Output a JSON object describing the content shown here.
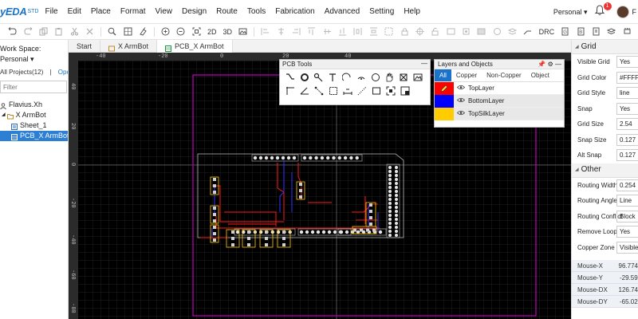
{
  "app": {
    "logo": "yEDA",
    "logo_suffix": "STD"
  },
  "menu": [
    "File",
    "Edit",
    "Place",
    "Format",
    "View",
    "Design",
    "Route",
    "Tools",
    "Fabrication",
    "Advanced",
    "Setting",
    "Help"
  ],
  "account": {
    "workspace_dropdown": "Personal",
    "notification_count": "1",
    "user_initial": "F"
  },
  "toolbar": {
    "zoom_2d": "2D",
    "zoom_3d": "3D",
    "drc": "DRC"
  },
  "left_panel": {
    "workspace_label": "Work Space:",
    "workspace_value": "Personal",
    "projects_label": "All Projects(12)",
    "projects_sep": "|",
    "open_label": "Ope",
    "filter_placeholder": "Filter",
    "tree": [
      {
        "label": "Flavius.Xh"
      },
      {
        "label": "X ArmBot"
      },
      {
        "label": "Sheet_1"
      },
      {
        "label": "PCB_X ArmBot"
      }
    ]
  },
  "tabs": [
    "Start",
    "X ArmBot",
    "PCB_X ArmBot"
  ],
  "ruler": {
    "top": [
      "-40",
      "-20",
      "0",
      "20",
      "40"
    ],
    "left": [
      "40",
      "20",
      "0",
      "-20",
      "-40",
      "-60",
      "-80"
    ]
  },
  "pcb_tools": {
    "title": "PCB Tools",
    "minimize": "—"
  },
  "layers": {
    "title": "Layers and Objects",
    "tabs": [
      "All",
      "Copper",
      "Non-Copper",
      "Object"
    ],
    "items": [
      {
        "name": "TopLayer",
        "color": "#ff0000"
      },
      {
        "name": "BottomLayer",
        "color": "#0000ff"
      },
      {
        "name": "TopSilkLayer",
        "color": "#ffcc00"
      }
    ]
  },
  "properties": {
    "grid_section": "Grid",
    "grid": [
      {
        "label": "Visible Grid",
        "value": "Yes"
      },
      {
        "label": "Grid Color",
        "value": "#FFFFFF"
      },
      {
        "label": "Grid Style",
        "value": "line"
      },
      {
        "label": "Snap",
        "value": "Yes"
      },
      {
        "label": "Grid Size",
        "value": "2.54"
      },
      {
        "label": "Snap Size",
        "value": "0.127"
      },
      {
        "label": "Alt Snap",
        "value": "0.127"
      }
    ],
    "other_section": "Other",
    "other": [
      {
        "label": "Routing Width",
        "value": "0.254"
      },
      {
        "label": "Routing Angle",
        "value": "Line"
      },
      {
        "label": "Routing Conflict",
        "value": "Block"
      },
      {
        "label": "Remove Loop",
        "value": "Yes"
      },
      {
        "label": "Copper Zone",
        "value": "Visible"
      }
    ],
    "mouse": [
      {
        "label": "Mouse-X",
        "value": "96.774"
      },
      {
        "label": "Mouse-Y",
        "value": "-29.59"
      },
      {
        "label": "Mouse-DX",
        "value": "126.74"
      },
      {
        "label": "Mouse-DY",
        "value": "-65.02"
      }
    ]
  },
  "colors": {
    "accent": "#1a73c8",
    "canvas_bg": "#000000",
    "board_outline": "#c000c0",
    "silk": "#ffcc00",
    "top_copper": "#ff0000",
    "bottom_copper": "#0000ff"
  }
}
